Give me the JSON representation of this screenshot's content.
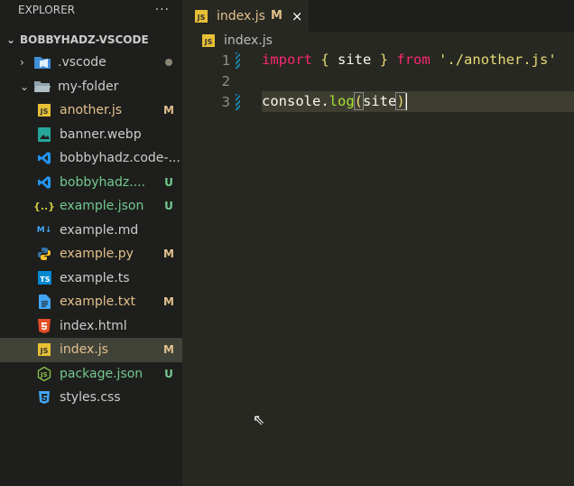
{
  "sidebar": {
    "title": "EXPLORER",
    "more_icon": "ellipsis-icon",
    "root": "BOBBYHADZ-VSCODE",
    "items": [
      {
        "name": ".vscode",
        "type": "folder",
        "icon": "vscode-folder-icon",
        "status": "dot",
        "collapsed": true
      },
      {
        "name": "my-folder",
        "type": "folder",
        "icon": "folder-open-icon",
        "collapsed": false
      },
      {
        "name": "another.js",
        "icon": "js-icon",
        "badge": "M",
        "status": "modified"
      },
      {
        "name": "banner.webp",
        "icon": "image-icon"
      },
      {
        "name": "bobbyhadz.code-...",
        "icon": "vscode-icon"
      },
      {
        "name": "bobbyhadz....",
        "icon": "vscode-icon",
        "badge": "U",
        "status": "untracked"
      },
      {
        "name": "example.json",
        "icon": "json-icon",
        "badge": "U",
        "status": "untracked"
      },
      {
        "name": "example.md",
        "icon": "markdown-icon"
      },
      {
        "name": "example.py",
        "icon": "python-icon",
        "badge": "M",
        "status": "modified"
      },
      {
        "name": "example.ts",
        "icon": "typescript-icon"
      },
      {
        "name": "example.txt",
        "icon": "text-file-icon",
        "badge": "M",
        "status": "modified"
      },
      {
        "name": "index.html",
        "icon": "html5-icon"
      },
      {
        "name": "index.js",
        "icon": "js-icon",
        "badge": "M",
        "status": "modified",
        "selected": true
      },
      {
        "name": "package.json",
        "icon": "nodejs-icon",
        "badge": "U",
        "status": "untracked"
      },
      {
        "name": "styles.css",
        "icon": "css3-icon"
      }
    ]
  },
  "tab": {
    "label": "index.js",
    "badge": "M",
    "close": "×"
  },
  "breadcrumb": "index.js",
  "editor": {
    "lines": [
      {
        "n": "1",
        "tokens": [
          [
            "import",
            "kw"
          ],
          [
            " ",
            "pn"
          ],
          [
            "{",
            "br"
          ],
          [
            " site ",
            "pn"
          ],
          [
            "}",
            "br"
          ],
          [
            " ",
            "pn"
          ],
          [
            "from",
            "kw"
          ],
          [
            " './another.js'",
            "str"
          ]
        ]
      },
      {
        "n": "2",
        "tokens": []
      },
      {
        "n": "3",
        "tokens": [
          [
            "console.",
            "pn"
          ],
          [
            "log",
            "fn"
          ],
          [
            "(",
            "br bm"
          ],
          [
            "site",
            "pn"
          ],
          [
            ")",
            "br bm"
          ]
        ]
      }
    ]
  },
  "colors": {
    "modified": "#e2c08d",
    "untracked": "#73c991",
    "sidebar_bg": "#1e1f1c",
    "editor_bg": "#272822",
    "selection": "#414339"
  }
}
